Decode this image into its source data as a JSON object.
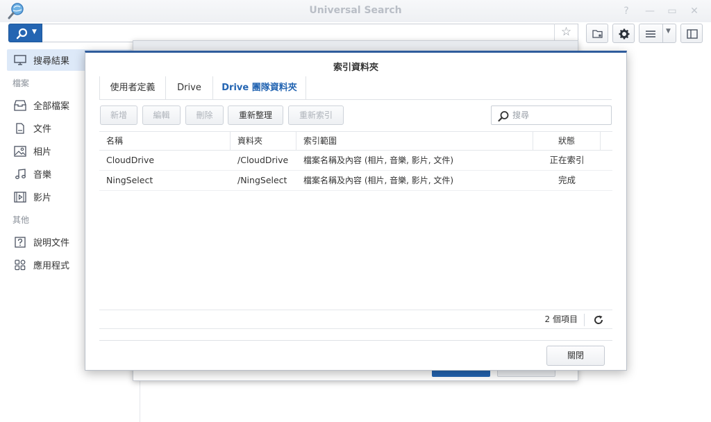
{
  "window": {
    "title": "Universal Search",
    "controls": {
      "help": "?",
      "minimize": "—",
      "maximize": "▭",
      "close": "✕"
    }
  },
  "toolbar": {
    "search_value": "",
    "star_glyph": "☆"
  },
  "sidebar": {
    "items": [
      {
        "label": "搜尋結果",
        "icon": "monitor-icon",
        "active": true
      },
      {
        "label": "全部檔案",
        "icon": "inbox-icon"
      },
      {
        "label": "文件",
        "icon": "document-icon"
      },
      {
        "label": "相片",
        "icon": "photo-icon"
      },
      {
        "label": "音樂",
        "icon": "music-icon"
      },
      {
        "label": "影片",
        "icon": "video-icon"
      },
      {
        "label": "說明文件",
        "icon": "help-icon"
      },
      {
        "label": "應用程式",
        "icon": "apps-icon"
      }
    ],
    "sections": {
      "files": "檔案",
      "other": "其他"
    }
  },
  "dialog": {
    "title": "索引資料夾",
    "tabs": [
      {
        "label": "使用者定義",
        "active": false
      },
      {
        "label": "Drive",
        "active": false
      },
      {
        "label": "Drive 團隊資料夾",
        "active": true
      }
    ],
    "buttons": {
      "add": "新增",
      "edit": "編輯",
      "delete": "刪除",
      "reorganize": "重新整理",
      "reindex": "重新索引"
    },
    "search_placeholder": "搜尋",
    "columns": {
      "name": "名稱",
      "folder": "資料夾",
      "range": "索引範圍",
      "status": "狀態"
    },
    "rows": [
      {
        "name": "CloudDrive",
        "folder": "/CloudDrive",
        "range": "檔案名稱及內容 (相片, 音樂, 影片, 文件)",
        "status": "正在索引"
      },
      {
        "name": "NingSelect",
        "folder": "/NingSelect",
        "range": "檔案名稱及內容 (相片, 音樂, 影片, 文件)",
        "status": "完成"
      }
    ],
    "item_count": "2 個項目",
    "close_label": "關閉"
  },
  "colors": {
    "accent": "#2465b2",
    "sidebar_active": "#dde9f8",
    "dialog_border_top": "#2f5c9c"
  }
}
